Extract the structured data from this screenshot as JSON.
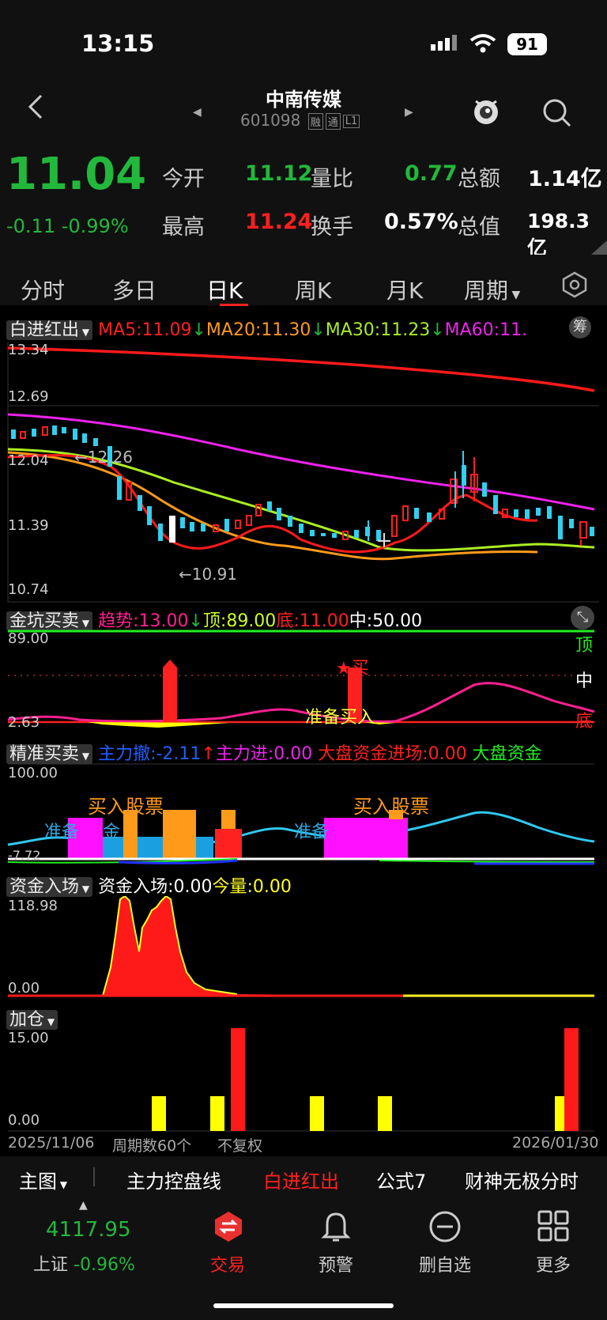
{
  "status": {
    "time": "13:15",
    "battery": "91"
  },
  "header": {
    "name": "中南传媒",
    "code": "601098",
    "tags": [
      "融",
      "通",
      "L1"
    ]
  },
  "quote": {
    "price": "11.04",
    "change": "-0.11 -0.99%",
    "open_label": "今开",
    "open": "11.12",
    "ratio_label": "量比",
    "ratio": "0.77",
    "amount_label": "总额",
    "amount": "1.14亿",
    "high_label": "最高",
    "high": "11.24",
    "turnover_label": "换手",
    "turnover": "0.57%",
    "cap_label": "总值",
    "cap": "198.3亿"
  },
  "tabs": [
    "分时",
    "多日",
    "日K",
    "周K",
    "月K",
    "周期"
  ],
  "main_chart": {
    "indicator": "白进红出",
    "ma5": "MA5:11.09",
    "ma20": "MA20:11.30",
    "ma30": "MA30:11.23",
    "ma60": "MA60:11.",
    "chip_label": "筹",
    "y_labels": [
      "13.34",
      "12.69",
      "12.04",
      "11.39",
      "10.74"
    ],
    "hi_label": "12.26",
    "lo_label": "10.91"
  },
  "panel2": {
    "name": "金坑买卖",
    "trend": "趋势:13.00",
    "top": "顶:89.00",
    "bottom": "底:11.00",
    "mid": "中:50.00",
    "y_top": "89.00",
    "y_bot": "2.63",
    "right_top": "顶",
    "right_mid": "中",
    "right_bot": "底",
    "buy_mark": "★买",
    "prepare": "准备买入"
  },
  "panel3": {
    "name": "精准买卖",
    "retreat": "主力撤:-2.11",
    "enter": "主力进:0.00",
    "market": "大盘资金进场:0.00",
    "market2": "大盘资金",
    "y_top": "100.00",
    "y_bot": "-7.72",
    "buy1": "买入股票",
    "buy2": "买入股票",
    "prep1": "准备",
    "prep1b": "金",
    "prep2": "准备"
  },
  "panel4": {
    "name": "资金入场",
    "val": "资金入场:0.00",
    "today": "今量:0.00",
    "y_top": "118.98",
    "y_bot": "0.00"
  },
  "panel5": {
    "name": "加仓",
    "y_top": "15.00",
    "y_bot": "0.00"
  },
  "axis": {
    "start": "2025/11/06",
    "period": "周期数60个",
    "adjust": "不复权",
    "end": "2026/01/30"
  },
  "bottom_tabs": [
    "主图",
    "主力控盘线",
    "白进红出",
    "公式7",
    "财神无极分时"
  ],
  "footer": {
    "index_value": "4117.95",
    "index_name": "上证",
    "index_change": "-0.96%",
    "trade": "交易",
    "alert": "预警",
    "remove": "删自选",
    "more": "更多"
  },
  "colors": {
    "up": "#ff2020",
    "down": "#22b83c",
    "cyan": "#30d0f0"
  }
}
